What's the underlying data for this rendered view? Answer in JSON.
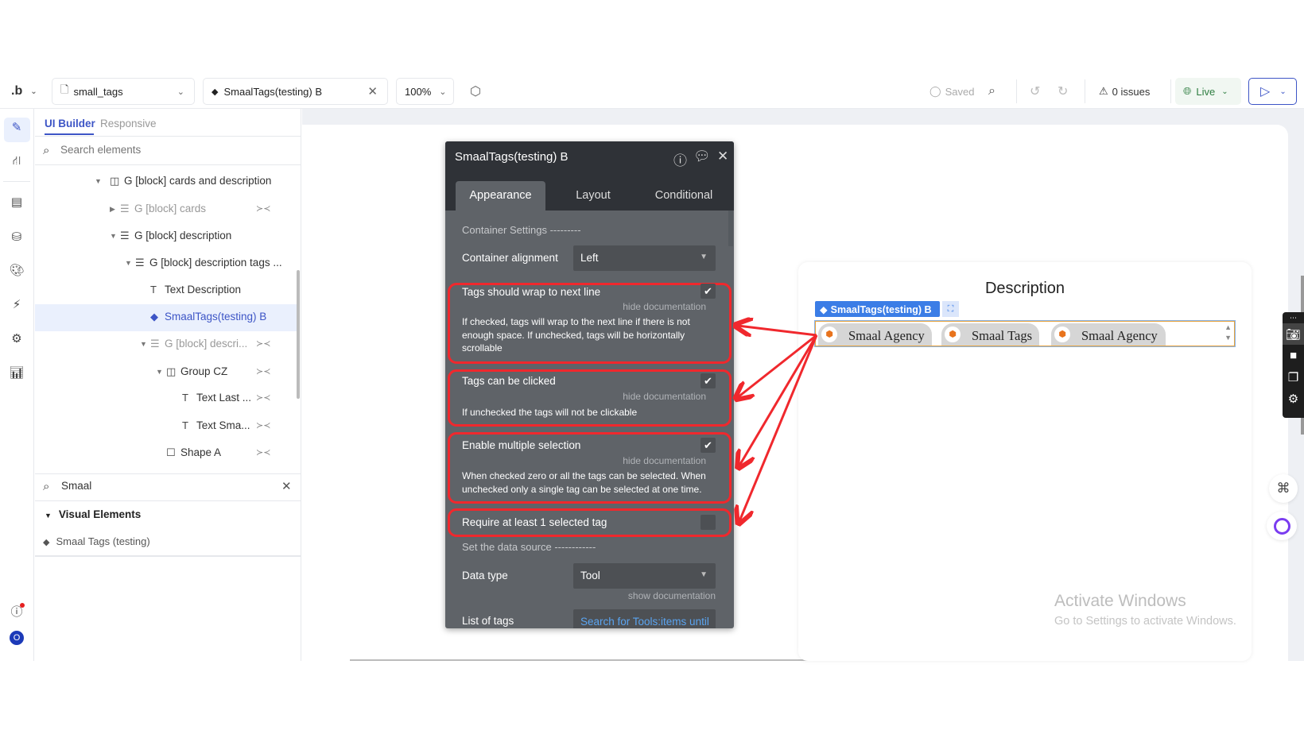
{
  "toolbar": {
    "logo": ".b",
    "page_name": "small_tags",
    "element_name": "SmaalTags(testing) B",
    "zoom": "100%",
    "saved": "Saved",
    "issues": "0 issues",
    "live": "Live"
  },
  "left_panel": {
    "tabs": [
      "UI Builder",
      "Responsive"
    ],
    "search_placeholder": "Search elements",
    "tree": [
      {
        "label": "G [block] cards and description",
        "icon": "group-columns-icon",
        "expanded": true
      },
      {
        "label": "G [block] cards",
        "icon": "group-rows-icon",
        "expanded": false,
        "hidden": true
      },
      {
        "label": "G [block] description",
        "icon": "group-rows-icon",
        "expanded": true
      },
      {
        "label": "G [block] description tags ...",
        "icon": "group-rows-icon",
        "expanded": true
      },
      {
        "label": "Text Description",
        "icon": "text-icon"
      },
      {
        "label": "SmaalTags(testing) B",
        "icon": "tag-icon",
        "selected": true
      },
      {
        "label": "G [block] descri...",
        "icon": "group-rows-icon",
        "expanded": true,
        "hidden": true
      },
      {
        "label": "Group CZ",
        "icon": "group-columns-icon",
        "expanded": true,
        "hidden": true
      },
      {
        "label": "Text Last ...",
        "icon": "text-icon",
        "hidden": true
      },
      {
        "label": "Text Sma...",
        "icon": "text-icon",
        "hidden": true
      },
      {
        "label": "Shape A",
        "icon": "shape-icon",
        "hidden": true
      }
    ],
    "element_search_value": "Smaal",
    "results_header": "Visual Elements",
    "results": [
      "Smaal Tags (testing)"
    ]
  },
  "property_editor": {
    "title": "SmaalTags(testing) B",
    "tabs": [
      "Appearance",
      "Layout",
      "Conditional"
    ],
    "active_tab": "Appearance",
    "section_container": "Container Settings ---------",
    "container_alignment_label": "Container alignment",
    "container_alignment_value": "Left",
    "options": [
      {
        "label": "Tags should wrap to next line",
        "checked": true,
        "doc_link": "hide documentation",
        "doc": "If checked, tags will wrap to the next line if there is not enough space. If unchecked, tags will be horizontally scrollable"
      },
      {
        "label": "Tags can be clicked",
        "checked": true,
        "doc_link": "hide documentation",
        "doc": "If unchecked the tags will not be clickable"
      },
      {
        "label": "Enable multiple selection",
        "checked": true,
        "doc_link": "hide documentation",
        "doc": "When checked zero or all the tags can be selected. When unchecked only a single tag can be selected at one time."
      },
      {
        "label": "Require at least 1 selected tag",
        "checked": false
      }
    ],
    "section_data": "Set the data source ------------",
    "data_type_label": "Data type",
    "data_type_value": "Tool",
    "data_type_doc_link": "show documentation",
    "list_of_tags_label": "List of tags",
    "list_of_tags_value": "Search for Tools:items until"
  },
  "canvas": {
    "card_title": "Description",
    "selected_label": "SmaalTags(testing) B",
    "tags": [
      "Smaal Agency",
      "Smaal Tags",
      "Smaal Agency"
    ],
    "watermark_title": "Activate Windows",
    "watermark_sub": "Go to Settings to activate Windows."
  },
  "colors": {
    "accent": "#3d55c6",
    "highlight": "#f0282d",
    "panel": "#5f6368",
    "panel_header": "#2f3237",
    "tag_label": "#3b7de6",
    "tag_box_border": "#e8a33d"
  }
}
